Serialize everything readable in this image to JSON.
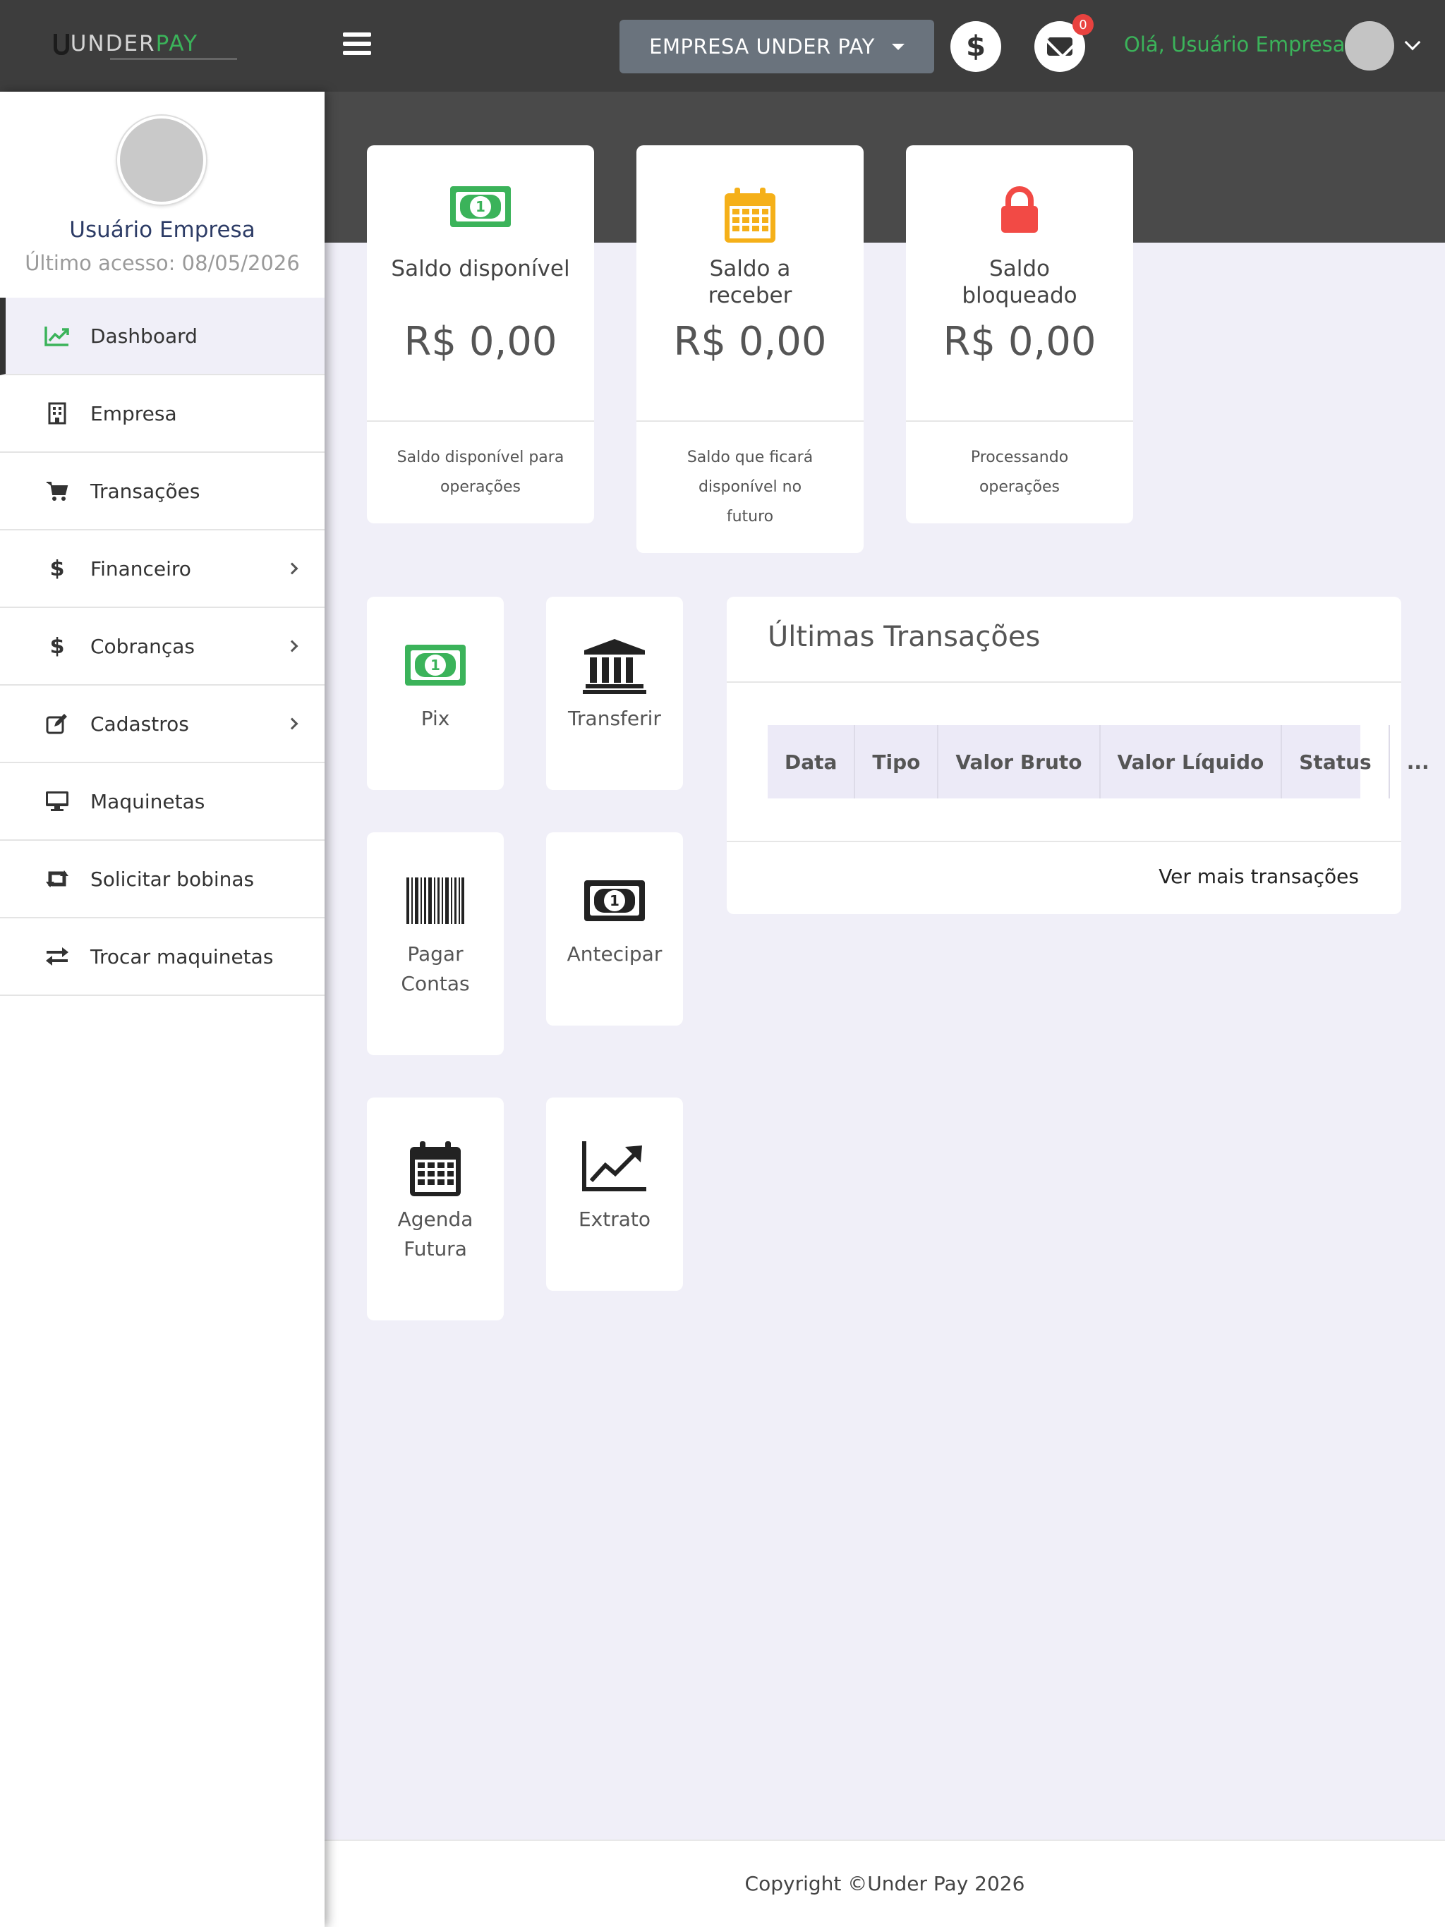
{
  "header": {
    "logo_under": "UNDER",
    "logo_pay": "PAY",
    "company": "EMPRESA UNDER PAY",
    "dollar_symbol": "$",
    "mail_badge": "0",
    "greeting": "Olá, Usuário Empresa"
  },
  "sidebar": {
    "user_name": "Usuário Empresa",
    "last_access": "Último acesso: 08/05/2026",
    "items": [
      {
        "label": "Dashboard",
        "icon": "chart-line-icon"
      },
      {
        "label": "Empresa",
        "icon": "building-icon"
      },
      {
        "label": "Transações",
        "icon": "cart-icon"
      },
      {
        "label": "Financeiro",
        "icon": "dollar-icon"
      },
      {
        "label": "Cobranças",
        "icon": "dollar-icon"
      },
      {
        "label": "Cadastros",
        "icon": "edit-icon"
      },
      {
        "label": "Maquinetas",
        "icon": "monitor-icon"
      },
      {
        "label": "Solicitar bobinas",
        "icon": "retweet-icon"
      },
      {
        "label": "Trocar maquinetas",
        "icon": "exchange-icon"
      }
    ]
  },
  "balances": [
    {
      "label": "Saldo disponível",
      "amount": "R$ 0,00",
      "desc": "Saldo disponível para operações",
      "icon": "money-bill-icon",
      "color": "#3bb35a"
    },
    {
      "label": "Saldo a receber",
      "amount": "R$ 0,00",
      "desc": "Saldo que ficará disponível no futuro",
      "icon": "calendar-icon",
      "color": "#f5b019"
    },
    {
      "label": "Saldo bloqueado",
      "amount": "R$ 0,00",
      "desc": "Processando operações",
      "icon": "lock-icon",
      "color": "#f24a45"
    }
  ],
  "actions": [
    {
      "label": "Pix",
      "icon": "money-bill-icon"
    },
    {
      "label": "Transferir",
      "icon": "bank-icon"
    },
    {
      "label": "Pagar Contas",
      "icon": "barcode-icon"
    },
    {
      "label": "Antecipar",
      "icon": "money-bill-icon"
    },
    {
      "label": "Agenda Futura",
      "icon": "calendar-icon"
    },
    {
      "label": "Extrato",
      "icon": "chart-line-icon"
    }
  ],
  "transactions": {
    "title": "Últimas Transações",
    "columns": [
      "Data",
      "Tipo",
      "Valor Bruto",
      "Valor Líquido",
      "Status",
      "..."
    ],
    "more": "Ver mais transações"
  },
  "footer": {
    "copyright": "Copyright ©Under Pay 2026"
  },
  "colors": {
    "accent_green": "#3bb35a",
    "topbar": "#3d3d3d",
    "background": "#f0eff8"
  }
}
